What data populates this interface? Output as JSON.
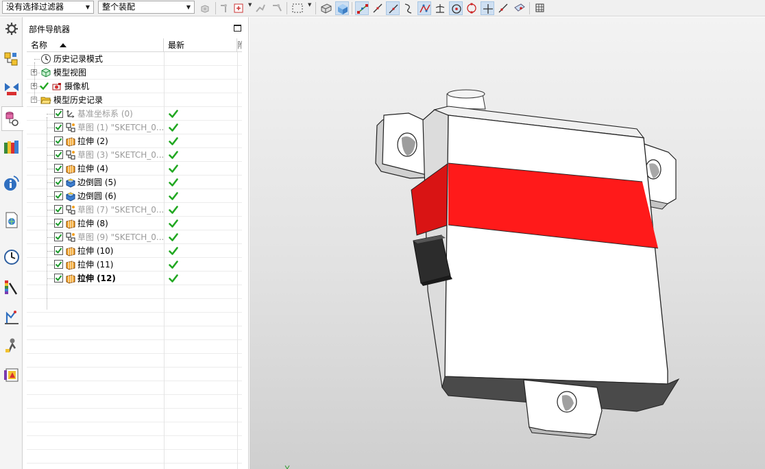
{
  "toolbar": {
    "selection_filter": "没有选择过滤器",
    "assembly_scope": "整个装配",
    "icons": [
      "assembly-icon",
      "snap-point-icon",
      "snap-point-options-icon",
      "fit-icon",
      "rectangle-select-icon",
      "shaded-with-edges-icon",
      "shaded-icon",
      "end-point-icon",
      "mid-point-icon",
      "line-icon",
      "curve-icon",
      "intersection-icon",
      "perpendicular-icon",
      "circle-center-icon",
      "quadrant-icon",
      "point-icon",
      "point-on-curve-icon",
      "face-icon",
      "grid-icon"
    ]
  },
  "resource_bar": {
    "items": [
      "gear-icon",
      "assembly-navigator-icon",
      "constraint-navigator-icon",
      "part-navigator-icon",
      "reuse-library-icon",
      "info-icon",
      "web-browser-icon",
      "history-icon",
      "system-materials-icon",
      "process-studio-icon",
      "roles-icon",
      "palette-icon"
    ]
  },
  "navigator": {
    "title": "部件导航器",
    "columns": {
      "name": "名称",
      "latest": "最新",
      "extra": "附"
    },
    "rows": [
      {
        "label": "历史记录模式",
        "icon": "clock-icon",
        "level": 0,
        "style": "normal",
        "latest": false
      },
      {
        "label": "模型视图",
        "icon": "model-views-icon",
        "level": 0,
        "style": "normal",
        "latest": false
      },
      {
        "label": "摄像机",
        "icon": "camera-icon",
        "level": 0,
        "style": "normal",
        "latest": false
      },
      {
        "label": "模型历史记录",
        "icon": "folder-open-icon",
        "level": 0,
        "style": "normal",
        "latest": false
      },
      {
        "label": "基准坐标系 (0)",
        "icon": "datum-csys-icon",
        "level": 1,
        "style": "dim",
        "latest": true
      },
      {
        "label": "草图 (1) \"SKETCH_0...",
        "icon": "sketch-icon",
        "level": 1,
        "style": "dim",
        "latest": true
      },
      {
        "label": "拉伸 (2)",
        "icon": "extrude-icon",
        "level": 1,
        "style": "normal",
        "latest": true
      },
      {
        "label": "草图 (3) \"SKETCH_0...",
        "icon": "sketch-icon",
        "level": 1,
        "style": "dim",
        "latest": true
      },
      {
        "label": "拉伸 (4)",
        "icon": "extrude-icon",
        "level": 1,
        "style": "normal",
        "latest": true
      },
      {
        "label": "边倒圆 (5)",
        "icon": "edge-blend-icon",
        "level": 1,
        "style": "normal",
        "latest": true
      },
      {
        "label": "边倒圆 (6)",
        "icon": "edge-blend-icon",
        "level": 1,
        "style": "normal",
        "latest": true
      },
      {
        "label": "草图 (7) \"SKETCH_0...",
        "icon": "sketch-icon",
        "level": 1,
        "style": "dim",
        "latest": true
      },
      {
        "label": "拉伸 (8)",
        "icon": "extrude-icon",
        "level": 1,
        "style": "normal",
        "latest": true
      },
      {
        "label": "草图 (9) \"SKETCH_0...",
        "icon": "sketch-icon",
        "level": 1,
        "style": "dim",
        "latest": true
      },
      {
        "label": "拉伸 (10)",
        "icon": "extrude-icon",
        "level": 1,
        "style": "normal",
        "latest": true
      },
      {
        "label": "拉伸 (11)",
        "icon": "extrude-icon",
        "level": 1,
        "style": "normal",
        "latest": true
      },
      {
        "label": "拉伸 (12)",
        "icon": "extrude-icon",
        "level": 1,
        "style": "bold",
        "latest": true
      }
    ]
  },
  "viewport": {
    "model": "servo-housing-3d-model",
    "band_color": "#ff1a1a",
    "body_color": "#ffffff",
    "dark_color": "#4a4a4a"
  }
}
